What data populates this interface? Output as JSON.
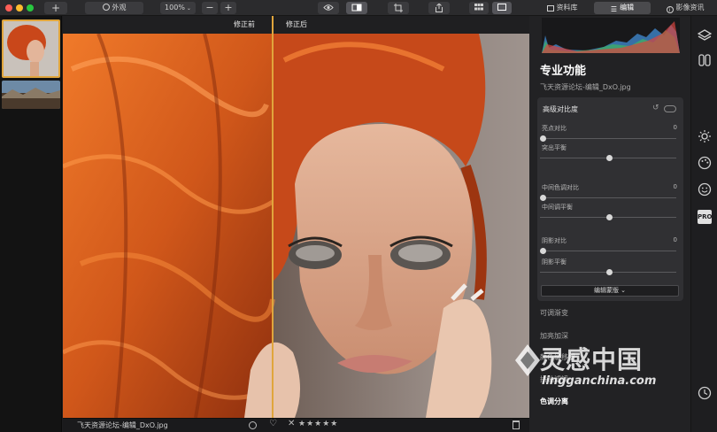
{
  "toolbar": {
    "add_label": "+",
    "appearance_label": "外观",
    "zoom_value": "100%",
    "zoom_out_label": "−",
    "zoom_in_label": "+"
  },
  "tabs": [
    {
      "label": "资料库"
    },
    {
      "label": "编辑"
    },
    {
      "label": "影像资讯"
    }
  ],
  "compare": {
    "before_label": "修正前",
    "after_label": "修正后"
  },
  "status": {
    "filename": "飞天资源论坛-编辑_DxO.jpg",
    "rating_stars": "★★★★★"
  },
  "panel": {
    "title": "专业功能",
    "filename": "飞天资源论坛-编辑_DxO.jpg",
    "card_title": "高级对比度",
    "sliders": [
      {
        "label": "亮点对比",
        "value": "0",
        "level": 0.0
      },
      {
        "label": "突出平衡",
        "value": "",
        "level": 0.5
      },
      {
        "label": "中间色调对比",
        "value": "0",
        "level": 0.0
      },
      {
        "label": "中间调平衡",
        "value": "",
        "level": 0.5
      },
      {
        "label": "阴影对比",
        "value": "0",
        "level": 0.0
      },
      {
        "label": "阴影平衡",
        "value": "",
        "level": 0.5
      }
    ],
    "card_button": "编辑蒙版 ⌄",
    "sections": [
      "可调渐变",
      "加亮加深",
      "颜色缓移器",
      "拼贴滤镜",
      "色调分离"
    ]
  },
  "watermark": {
    "main": "灵感中国",
    "sub": "lingganchina.com"
  },
  "colors": {
    "accent": "#e0a53c",
    "panel_bg": "#222224",
    "card_bg": "#303033"
  }
}
